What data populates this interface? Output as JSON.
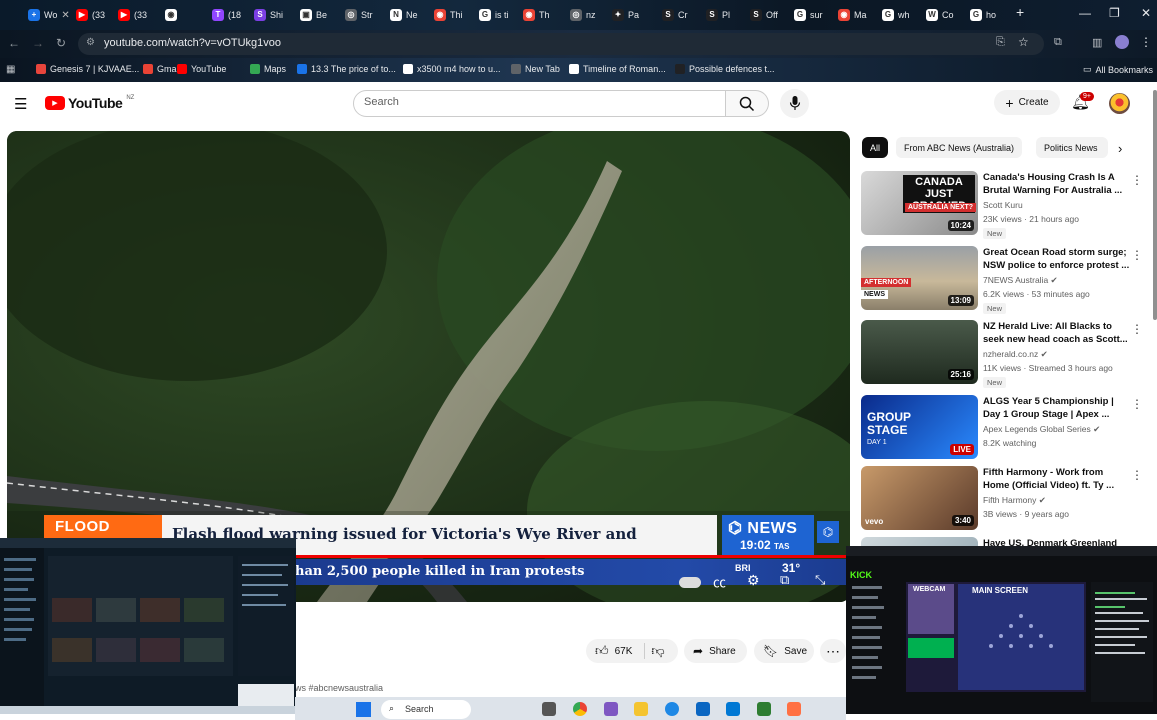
{
  "browser": {
    "tabs": [
      {
        "label": "Wo",
        "color": "#1a73e8",
        "glyph": "+"
      },
      {
        "label": "(33",
        "color": "#ff0000",
        "glyph": "▶"
      },
      {
        "label": "(33",
        "color": "#ff0000",
        "glyph": "▶"
      },
      {
        "label": "",
        "color": "#ffffff",
        "glyph": "◉"
      },
      {
        "label": "(18",
        "color": "#9146ff",
        "glyph": "T"
      },
      {
        "label": "Shi",
        "color": "#7b3fe4",
        "glyph": "S"
      },
      {
        "label": "Be",
        "color": "#ffffff",
        "glyph": "▣"
      },
      {
        "label": "Str",
        "color": "#5f6368",
        "glyph": "◎"
      },
      {
        "label": "Ne",
        "color": "#ffffff",
        "glyph": "N"
      },
      {
        "label": "Thi",
        "color": "#ea4335",
        "glyph": "◉"
      },
      {
        "label": "is ti",
        "color": "#ffffff",
        "glyph": "G"
      },
      {
        "label": "Th",
        "color": "#ea4335",
        "glyph": "◉"
      },
      {
        "label": "nz",
        "color": "#5f6368",
        "glyph": "◎"
      },
      {
        "label": "Pa",
        "color": "#202124",
        "glyph": "✦"
      },
      {
        "label": "Cr",
        "color": "#202124",
        "glyph": "S"
      },
      {
        "label": "Pl",
        "color": "#202124",
        "glyph": "S"
      },
      {
        "label": "Off",
        "color": "#202124",
        "glyph": "S"
      },
      {
        "label": "sur",
        "color": "#ffffff",
        "glyph": "G"
      },
      {
        "label": "Ma",
        "color": "#ea4335",
        "glyph": "◉"
      },
      {
        "label": "wh",
        "color": "#ffffff",
        "glyph": "G"
      },
      {
        "label": "Co",
        "color": "#ffffff",
        "glyph": "W"
      },
      {
        "label": "ho",
        "color": "#ffffff",
        "glyph": "G"
      }
    ],
    "url": "youtube.com/watch?v=vOTUkg1voo",
    "bookmarks": [
      {
        "label": "Genesis 7 | KJVAAE...",
        "color": "#e8453c"
      },
      {
        "label": "Gmail",
        "color": "#ea4335"
      },
      {
        "label": "YouTube",
        "color": "#ff0000"
      },
      {
        "label": "Maps",
        "color": "#34a853"
      },
      {
        "label": "13.3 The price of to...",
        "color": "#1a73e8"
      },
      {
        "label": "x3500 m4 how to u...",
        "color": "#ffffff"
      },
      {
        "label": "New Tab",
        "color": "#5f6368"
      },
      {
        "label": "Timeline of Roman...",
        "color": "#ffffff"
      },
      {
        "label": "Possible defences t...",
        "color": "#202124"
      }
    ],
    "all_bookmarks": "All Bookmarks"
  },
  "youtube": {
    "logo": "YouTube",
    "region": "NZ",
    "search_placeholder": "Search",
    "create_label": "Create",
    "notif_count": "9+"
  },
  "video": {
    "banner_tag": "FLOOD",
    "banner_text": "Flash flood warning issued for Victoria's Wye River and surrounds",
    "ticker_text": "han 2,500 people killed in Iran protests",
    "network": "NEWS",
    "time": "19:02",
    "timezone": "TAS",
    "weather_city": "BRI",
    "weather_temp": "31°"
  },
  "actions": {
    "likes": "67K",
    "share": "Share",
    "save": "Save"
  },
  "hashtag": "ws #abcnewsaustralia",
  "chips": [
    "All",
    "From ABC News (Australia)",
    "Politics News"
  ],
  "recommendations": [
    {
      "title": "Canada's Housing Crash Is A Brutal Warning For Australia ...",
      "channel": "Scott Kuru",
      "meta": "23K views · 21 hours ago",
      "badge": "New",
      "duration": "10:24",
      "thumb_text": "CANADA JUST CRASHED",
      "thumb_sub": "AUSTRALIA NEXT?"
    },
    {
      "title": "Great Ocean Road storm surge; NSW police to enforce protest ...",
      "channel": "7NEWS Australia",
      "meta": "6.2K views · 53 minutes ago",
      "badge": "New",
      "duration": "13:09",
      "thumb_text": "AFTERNOON",
      "thumb_sub": "NEWS"
    },
    {
      "title": "NZ Herald Live: All Blacks to seek new head coach as Scott...",
      "channel": "nzherald.co.nz",
      "meta": "11K views · Streamed 3 hours ago",
      "badge": "New",
      "duration": "25:16",
      "thumb_text": "",
      "thumb_sub": ""
    },
    {
      "title": "ALGS Year 5 Championship | Day 1 Group Stage | Apex ...",
      "channel": "Apex Legends Global Series",
      "meta": "8.2K watching",
      "badge": "",
      "duration": "LIVE",
      "thumb_text": "GROUP STAGE",
      "thumb_sub": "DAY 1"
    },
    {
      "title": "Fifth Harmony - Work from Home (Official Video) ft. Ty ...",
      "channel": "Fifth Harmony",
      "meta": "3B views · 9 years ago",
      "badge": "",
      "duration": "3:40",
      "thumb_text": "vevo",
      "thumb_sub": ""
    },
    {
      "title": "Have US, Denmark Greenland",
      "channel": "",
      "meta": "",
      "badge": "",
      "duration": "",
      "thumb_text": "",
      "thumb_sub": ""
    }
  ],
  "taskbar": {
    "search_placeholder": "Search"
  },
  "stream_overlay": {
    "title": "MAIN SCREEN",
    "webcam_label": "WEBCAM",
    "kick_logo": "KICK"
  }
}
